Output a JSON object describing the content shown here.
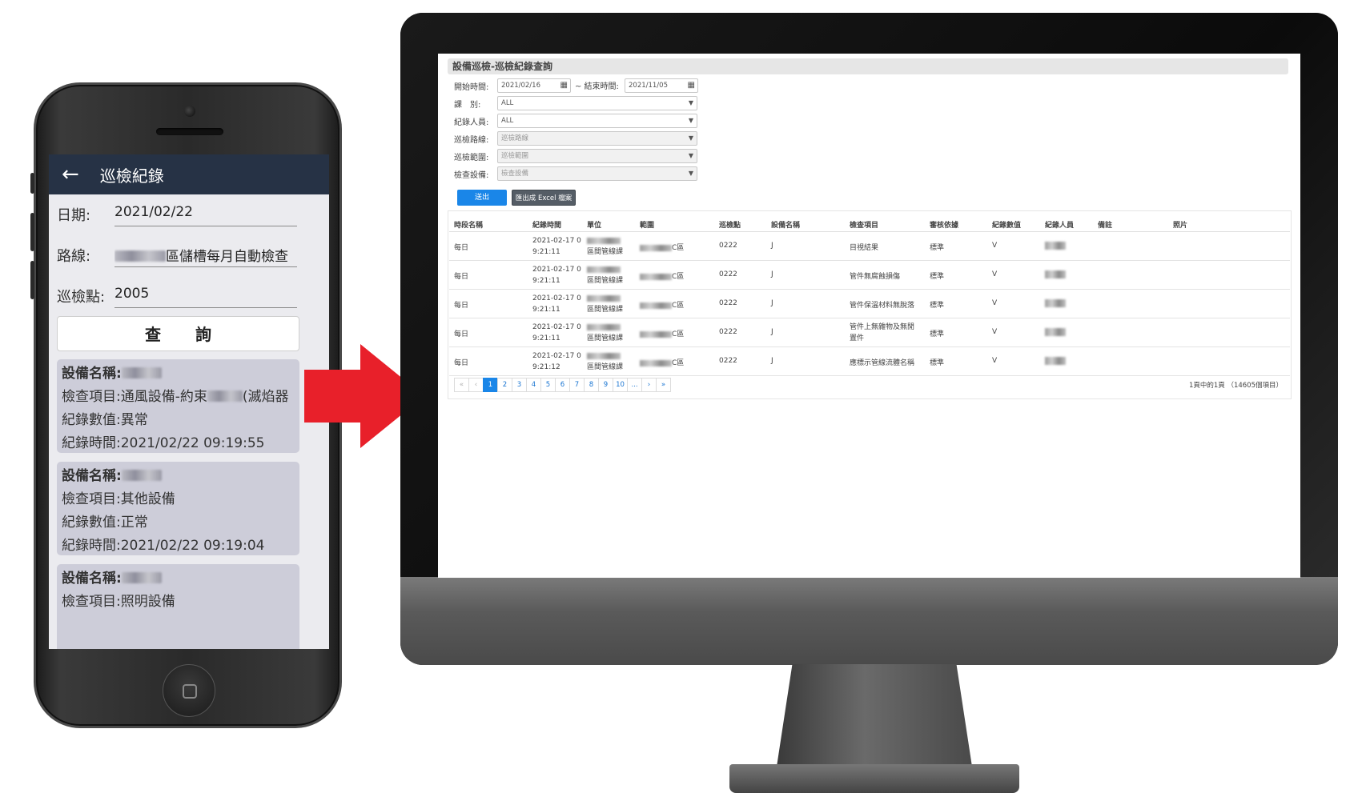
{
  "phone": {
    "title": "巡檢紀錄",
    "form": {
      "date_label": "日期:",
      "date_value": "2021/02/22",
      "route_label": "路線:",
      "route_value": "區儲槽每月自動檢查",
      "point_label": "巡檢點:",
      "point_value": "2005"
    },
    "query_button": "查 詢",
    "records": [
      {
        "name_label": "設備名稱:",
        "item_label": "檢查項目:",
        "item_value": "通風設備-約束",
        "item_value_suffix": "(滅焰器",
        "value_label": "紀錄數值:",
        "value": "異常",
        "time_label": "紀錄時間:",
        "time": "2021/02/22 09:19:55"
      },
      {
        "name_label": "設備名稱:",
        "item_label": "檢查項目:",
        "item_value": "其他設備",
        "value_label": "紀錄數值:",
        "value": "正常",
        "time_label": "紀錄時間:",
        "time": "2021/02/22 09:19:04"
      },
      {
        "name_label": "設備名稱:",
        "item_label": "檢查項目:",
        "item_value": "照明設備"
      }
    ]
  },
  "web": {
    "header": "設備巡檢-巡檢紀錄查詢",
    "filters": {
      "start_label": "開始時間:",
      "start_value": "2021/02/16",
      "end_label": "~ 結束時間:",
      "end_value": "2021/11/05",
      "class_label": "課　別:",
      "class_value": "ALL",
      "recorder_label": "紀錄人員:",
      "recorder_value": "ALL",
      "route_label": "巡檢路線:",
      "route_placeholder": "巡檢路線",
      "area_label": "巡檢範圍:",
      "area_placeholder": "巡檢範圍",
      "equip_label": "檢查設備:",
      "equip_placeholder": "檢查設備"
    },
    "submit_button": "送出",
    "excel_button": "匯出成 Excel 檔案",
    "columns": [
      "時段名稱",
      "紀錄時間",
      "單位",
      "範圍",
      "巡檢點",
      "設備名稱",
      "檢查項目",
      "審核依據",
      "紀錄數值",
      "紀錄人員",
      "備註",
      "照片"
    ],
    "rows": [
      {
        "period": "每日",
        "time1": "2021-02-17 0",
        "time2": "9:21:11",
        "unit": "區間管線課",
        "area": "C區",
        "point": "0222",
        "equip": "J",
        "item1": "目視結果",
        "item2": "",
        "basis": "標準",
        "value": "V"
      },
      {
        "period": "每日",
        "time1": "2021-02-17 0",
        "time2": "9:21:11",
        "unit": "區間管線課",
        "area": "C區",
        "point": "0222",
        "equip": "J",
        "item1": "管件無腐蝕損傷",
        "item2": "",
        "basis": "標準",
        "value": "V"
      },
      {
        "period": "每日",
        "time1": "2021-02-17 0",
        "time2": "9:21:11",
        "unit": "區間管線課",
        "area": "C區",
        "point": "0222",
        "equip": "J",
        "item1": "管件保溫材料無脫落",
        "item2": "",
        "basis": "標準",
        "value": "V"
      },
      {
        "period": "每日",
        "time1": "2021-02-17 0",
        "time2": "9:21:11",
        "unit": "區間管線課",
        "area": "C區",
        "point": "0222",
        "equip": "J",
        "item1": "管件上無雜物及無閒",
        "item2": "置件",
        "basis": "標準",
        "value": "V"
      },
      {
        "period": "每日",
        "time1": "2021-02-17 0",
        "time2": "9:21:12",
        "unit": "區間管線課",
        "area": "C區",
        "point": "0222",
        "equip": "J",
        "item1": "應標示管線流體名稱",
        "item2": "",
        "basis": "標準",
        "value": "V"
      }
    ],
    "pagination": {
      "first": "«",
      "prev": "‹",
      "pages": [
        "1",
        "2",
        "3",
        "4",
        "5",
        "6",
        "7",
        "8",
        "9",
        "10"
      ],
      "ellipsis": "...",
      "next": "›",
      "last": "»",
      "active_page": "1",
      "info": "1頁中的1頁 （14605個項目）"
    }
  },
  "colors": {
    "app_bar": "#263245",
    "card_bg": "#cdcdd9",
    "arrow": "#e8202a",
    "primary_button": "#1a86e8",
    "excel_button": "#555d66"
  },
  "icons": [
    "back-arrow-icon",
    "calendar-icon",
    "dropdown-caret-icon",
    "home-button-icon",
    "camera-icon"
  ]
}
